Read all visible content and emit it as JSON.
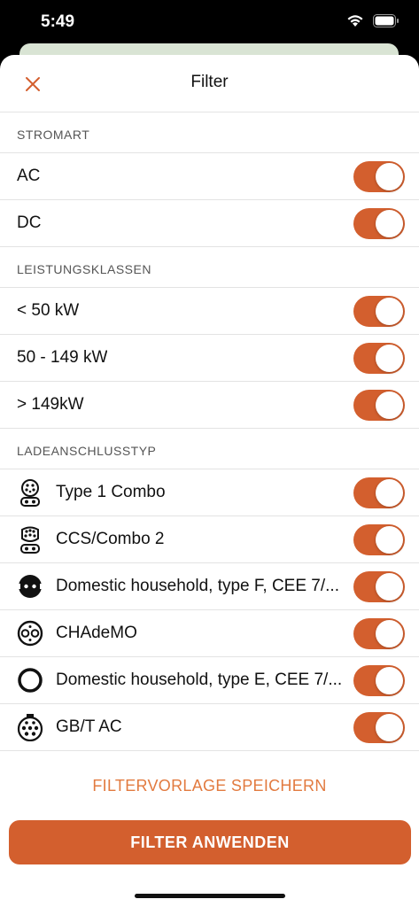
{
  "status_bar": {
    "time": "5:49"
  },
  "header": {
    "title": "Filter",
    "close_icon": "close-icon"
  },
  "sections": {
    "stromart": {
      "title": "STROMART",
      "items": [
        {
          "label": "AC",
          "on": true
        },
        {
          "label": "DC",
          "on": true
        }
      ]
    },
    "leistungsklassen": {
      "title": "LEISTUNGSKLASSEN",
      "items": [
        {
          "label": "< 50 kW",
          "on": true
        },
        {
          "label": "50 - 149 kW",
          "on": true
        },
        {
          "label": "> 149kW",
          "on": true
        }
      ]
    },
    "ladeanschlusstyp": {
      "title": "LADEANSCHLUSSTYP",
      "items": [
        {
          "label": "Type 1 Combo",
          "icon": "type1-combo-connector-icon",
          "on": true
        },
        {
          "label": "CCS/Combo 2",
          "icon": "ccs-combo2-connector-icon",
          "on": true
        },
        {
          "label": "Domestic household, type F, CEE 7/...",
          "icon": "schuko-type-f-connector-icon",
          "on": true
        },
        {
          "label": "CHAdeMO",
          "icon": "chademo-connector-icon",
          "on": true
        },
        {
          "label": "Domestic household, type E, CEE 7/...",
          "icon": "type-e-connector-icon",
          "on": true
        },
        {
          "label": "GB/T AC",
          "icon": "gbt-ac-connector-icon",
          "on": true
        }
      ]
    }
  },
  "footer": {
    "save_template_label": "FILTERVORLAGE SPEICHERN",
    "apply_label": "FILTER ANWENDEN"
  },
  "colors": {
    "accent": "#d35f2e",
    "link": "#e27a3f"
  }
}
